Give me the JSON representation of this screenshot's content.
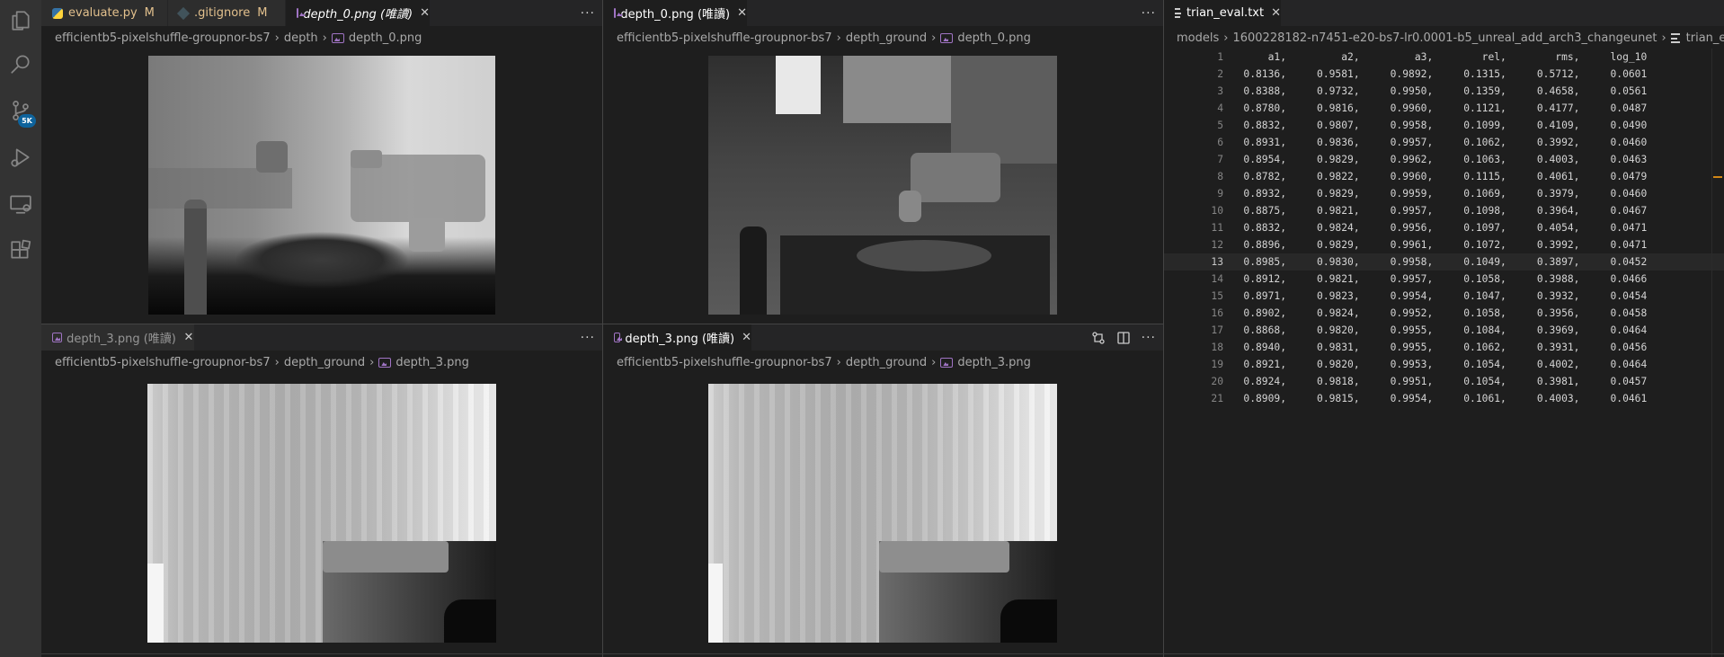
{
  "activity_bar": {
    "items": [
      {
        "name": "explorer-icon"
      },
      {
        "name": "search-icon"
      },
      {
        "name": "source-control-icon",
        "badge": "5K"
      },
      {
        "name": "run-debug-icon"
      },
      {
        "name": "remote-explorer-icon"
      },
      {
        "name": "extensions-icon"
      }
    ]
  },
  "group1": {
    "tabs": [
      {
        "label": "evaluate.py",
        "status": "M"
      },
      {
        "label": ".gitignore",
        "status": "M"
      },
      {
        "label": "depth_0.png (唯讀)",
        "close": "✕"
      }
    ],
    "more": "···",
    "breadcrumb": [
      "efficientb5-pixelshuffle-groupnor-bs7",
      "depth",
      "depth_0.png"
    ]
  },
  "group2": {
    "tabs": [
      {
        "label": "depth_0.png (唯讀)",
        "close": "✕"
      }
    ],
    "more": "···",
    "breadcrumb": [
      "efficientb5-pixelshuffle-groupnor-bs7",
      "depth_ground",
      "depth_0.png"
    ]
  },
  "group3": {
    "tabs": [
      {
        "label": "depth_3.png (唯讀)",
        "close": "✕"
      }
    ],
    "more": "···",
    "breadcrumb": [
      "efficientb5-pixelshuffle-groupnor-bs7",
      "depth_ground",
      "depth_3.png"
    ]
  },
  "group4": {
    "tabs": [
      {
        "label": "depth_3.png (唯讀)",
        "close": "✕"
      }
    ],
    "more": "···",
    "breadcrumb": [
      "efficientb5-pixelshuffle-groupnor-bs7",
      "depth_ground",
      "depth_3.png"
    ]
  },
  "group5": {
    "tabs": [
      {
        "label": "trian_eval.txt",
        "close": "✕"
      }
    ],
    "breadcrumb": [
      "models",
      "1600228182-n7451-e20-bs7-lr0.0001-b5_unreal_add_arch3_changeunet",
      "trian_eval.txt"
    ],
    "current_line": 13,
    "lines": [
      {
        "n": "1",
        "text": "       a1,         a2,         a3,        rel,        rms,     log_10"
      },
      {
        "n": "2",
        "text": "   0.8136,     0.9581,     0.9892,     0.1315,     0.5712,     0.0601"
      },
      {
        "n": "3",
        "text": "   0.8388,     0.9732,     0.9950,     0.1359,     0.4658,     0.0561"
      },
      {
        "n": "4",
        "text": "   0.8780,     0.9816,     0.9960,     0.1121,     0.4177,     0.0487"
      },
      {
        "n": "5",
        "text": "   0.8832,     0.9807,     0.9958,     0.1099,     0.4109,     0.0490"
      },
      {
        "n": "6",
        "text": "   0.8931,     0.9836,     0.9957,     0.1062,     0.3992,     0.0460"
      },
      {
        "n": "7",
        "text": "   0.8954,     0.9829,     0.9962,     0.1063,     0.4003,     0.0463"
      },
      {
        "n": "8",
        "text": "   0.8782,     0.9822,     0.9960,     0.1115,     0.4061,     0.0479"
      },
      {
        "n": "9",
        "text": "   0.8932,     0.9829,     0.9959,     0.1069,     0.3979,     0.0460"
      },
      {
        "n": "10",
        "text": "   0.8875,     0.9821,     0.9957,     0.1098,     0.3964,     0.0467"
      },
      {
        "n": "11",
        "text": "   0.8832,     0.9824,     0.9956,     0.1097,     0.4054,     0.0471"
      },
      {
        "n": "12",
        "text": "   0.8896,     0.9829,     0.9961,     0.1072,     0.3992,     0.0471"
      },
      {
        "n": "13",
        "text": "   0.8985,     0.9830,     0.9958,     0.1049,     0.3897,     0.0452"
      },
      {
        "n": "14",
        "text": "   0.8912,     0.9821,     0.9957,     0.1058,     0.3988,     0.0466"
      },
      {
        "n": "15",
        "text": "   0.8971,     0.9823,     0.9954,     0.1047,     0.3932,     0.0454"
      },
      {
        "n": "16",
        "text": "   0.8902,     0.9824,     0.9952,     0.1058,     0.3956,     0.0458"
      },
      {
        "n": "17",
        "text": "   0.8868,     0.9820,     0.9955,     0.1084,     0.3969,     0.0464"
      },
      {
        "n": "18",
        "text": "   0.8940,     0.9831,     0.9955,     0.1062,     0.3931,     0.0456"
      },
      {
        "n": "19",
        "text": "   0.8921,     0.9820,     0.9953,     0.1054,     0.4002,     0.0464"
      },
      {
        "n": "20",
        "text": "   0.8924,     0.9818,     0.9951,     0.1054,     0.3981,     0.0457"
      },
      {
        "n": "21",
        "text": "   0.8909,     0.9815,     0.9954,     0.1061,     0.4003,     0.0461"
      }
    ]
  }
}
